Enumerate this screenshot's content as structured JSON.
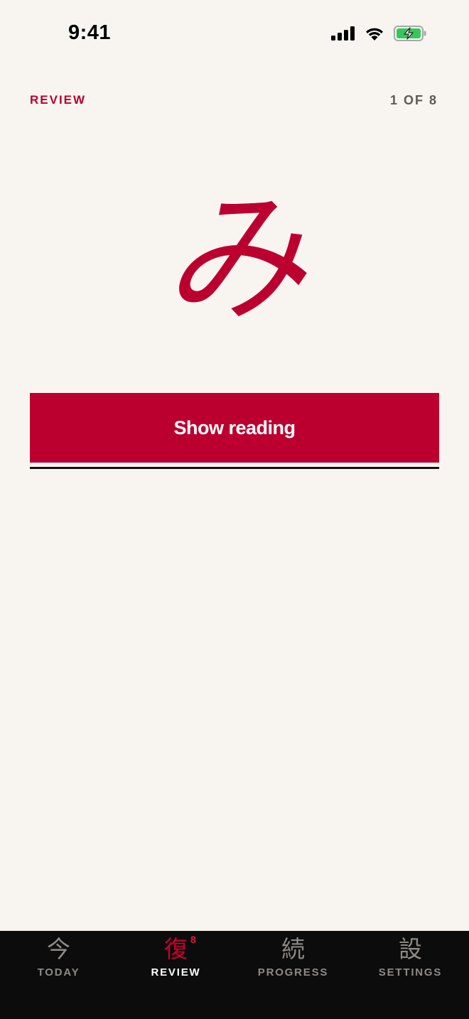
{
  "status_bar": {
    "time": "9:41",
    "icons": [
      "signal-icon",
      "wifi-icon",
      "battery-charging-icon"
    ],
    "battery_color": "#35c759"
  },
  "header": {
    "section_label": "REVIEW",
    "counter": "1 OF 8"
  },
  "card": {
    "kana": "み",
    "kana_color": "#bb0030"
  },
  "actions": {
    "show_reading_label": "Show reading",
    "accent": "#bb0030"
  },
  "tab_bar": {
    "tabs": [
      {
        "glyph": "今",
        "label": "TODAY",
        "active": false
      },
      {
        "glyph": "復",
        "label": "REVIEW",
        "active": true,
        "badge": "8"
      },
      {
        "glyph": "続",
        "label": "PROGRESS",
        "active": false
      },
      {
        "glyph": "設",
        "label": "SETTINGS",
        "active": false
      }
    ]
  }
}
